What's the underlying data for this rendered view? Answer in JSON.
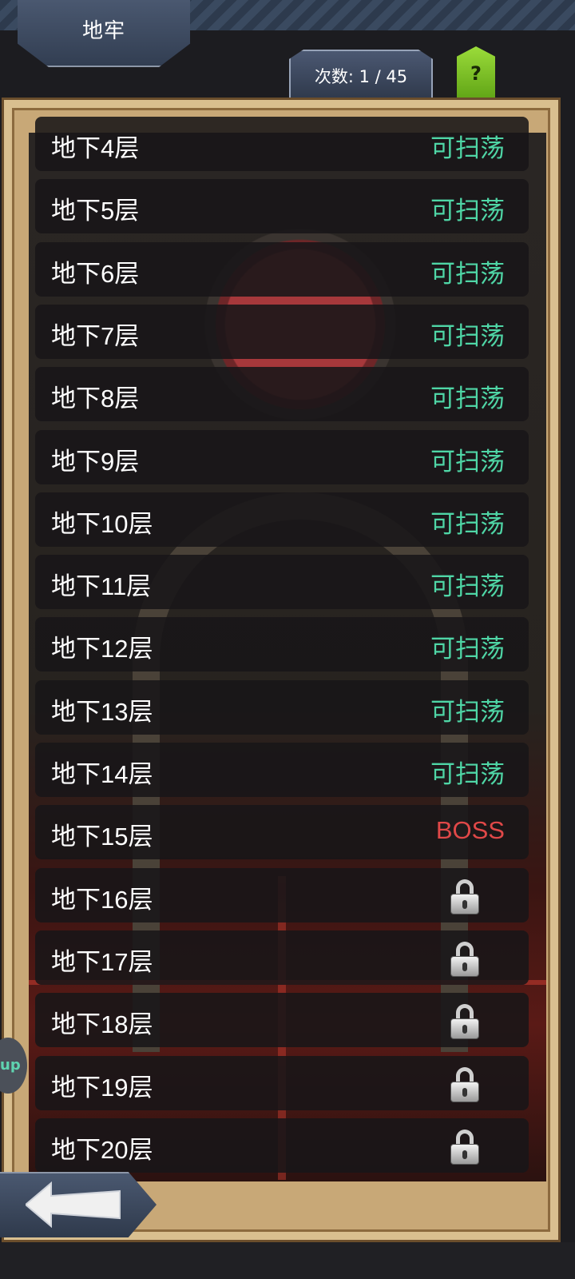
{
  "header": {
    "title": "地牢",
    "count_text": "次数: 1 / 45",
    "help_label": "?"
  },
  "floors": [
    {
      "name": "地下4层",
      "status": "可扫荡",
      "state": "sweep"
    },
    {
      "name": "地下5层",
      "status": "可扫荡",
      "state": "sweep"
    },
    {
      "name": "地下6层",
      "status": "可扫荡",
      "state": "sweep"
    },
    {
      "name": "地下7层",
      "status": "可扫荡",
      "state": "sweep"
    },
    {
      "name": "地下8层",
      "status": "可扫荡",
      "state": "sweep"
    },
    {
      "name": "地下9层",
      "status": "可扫荡",
      "state": "sweep"
    },
    {
      "name": "地下10层",
      "status": "可扫荡",
      "state": "sweep"
    },
    {
      "name": "地下11层",
      "status": "可扫荡",
      "state": "sweep"
    },
    {
      "name": "地下12层",
      "status": "可扫荡",
      "state": "sweep"
    },
    {
      "name": "地下13层",
      "status": "可扫荡",
      "state": "sweep"
    },
    {
      "name": "地下14层",
      "status": "可扫荡",
      "state": "sweep"
    },
    {
      "name": "地下15层",
      "status": "BOSS",
      "state": "boss"
    },
    {
      "name": "地下16层",
      "status": "",
      "state": "locked"
    },
    {
      "name": "地下17层",
      "status": "",
      "state": "locked"
    },
    {
      "name": "地下18层",
      "status": "",
      "state": "locked"
    },
    {
      "name": "地下19层",
      "status": "",
      "state": "locked"
    },
    {
      "name": "地下20层",
      "status": "",
      "state": "locked"
    }
  ],
  "side_tab_label": "up",
  "icons": {
    "lock": "lock-icon",
    "back": "back-arrow-icon"
  },
  "colors": {
    "sweep": "#4fd6a6",
    "boss": "#e04848"
  }
}
